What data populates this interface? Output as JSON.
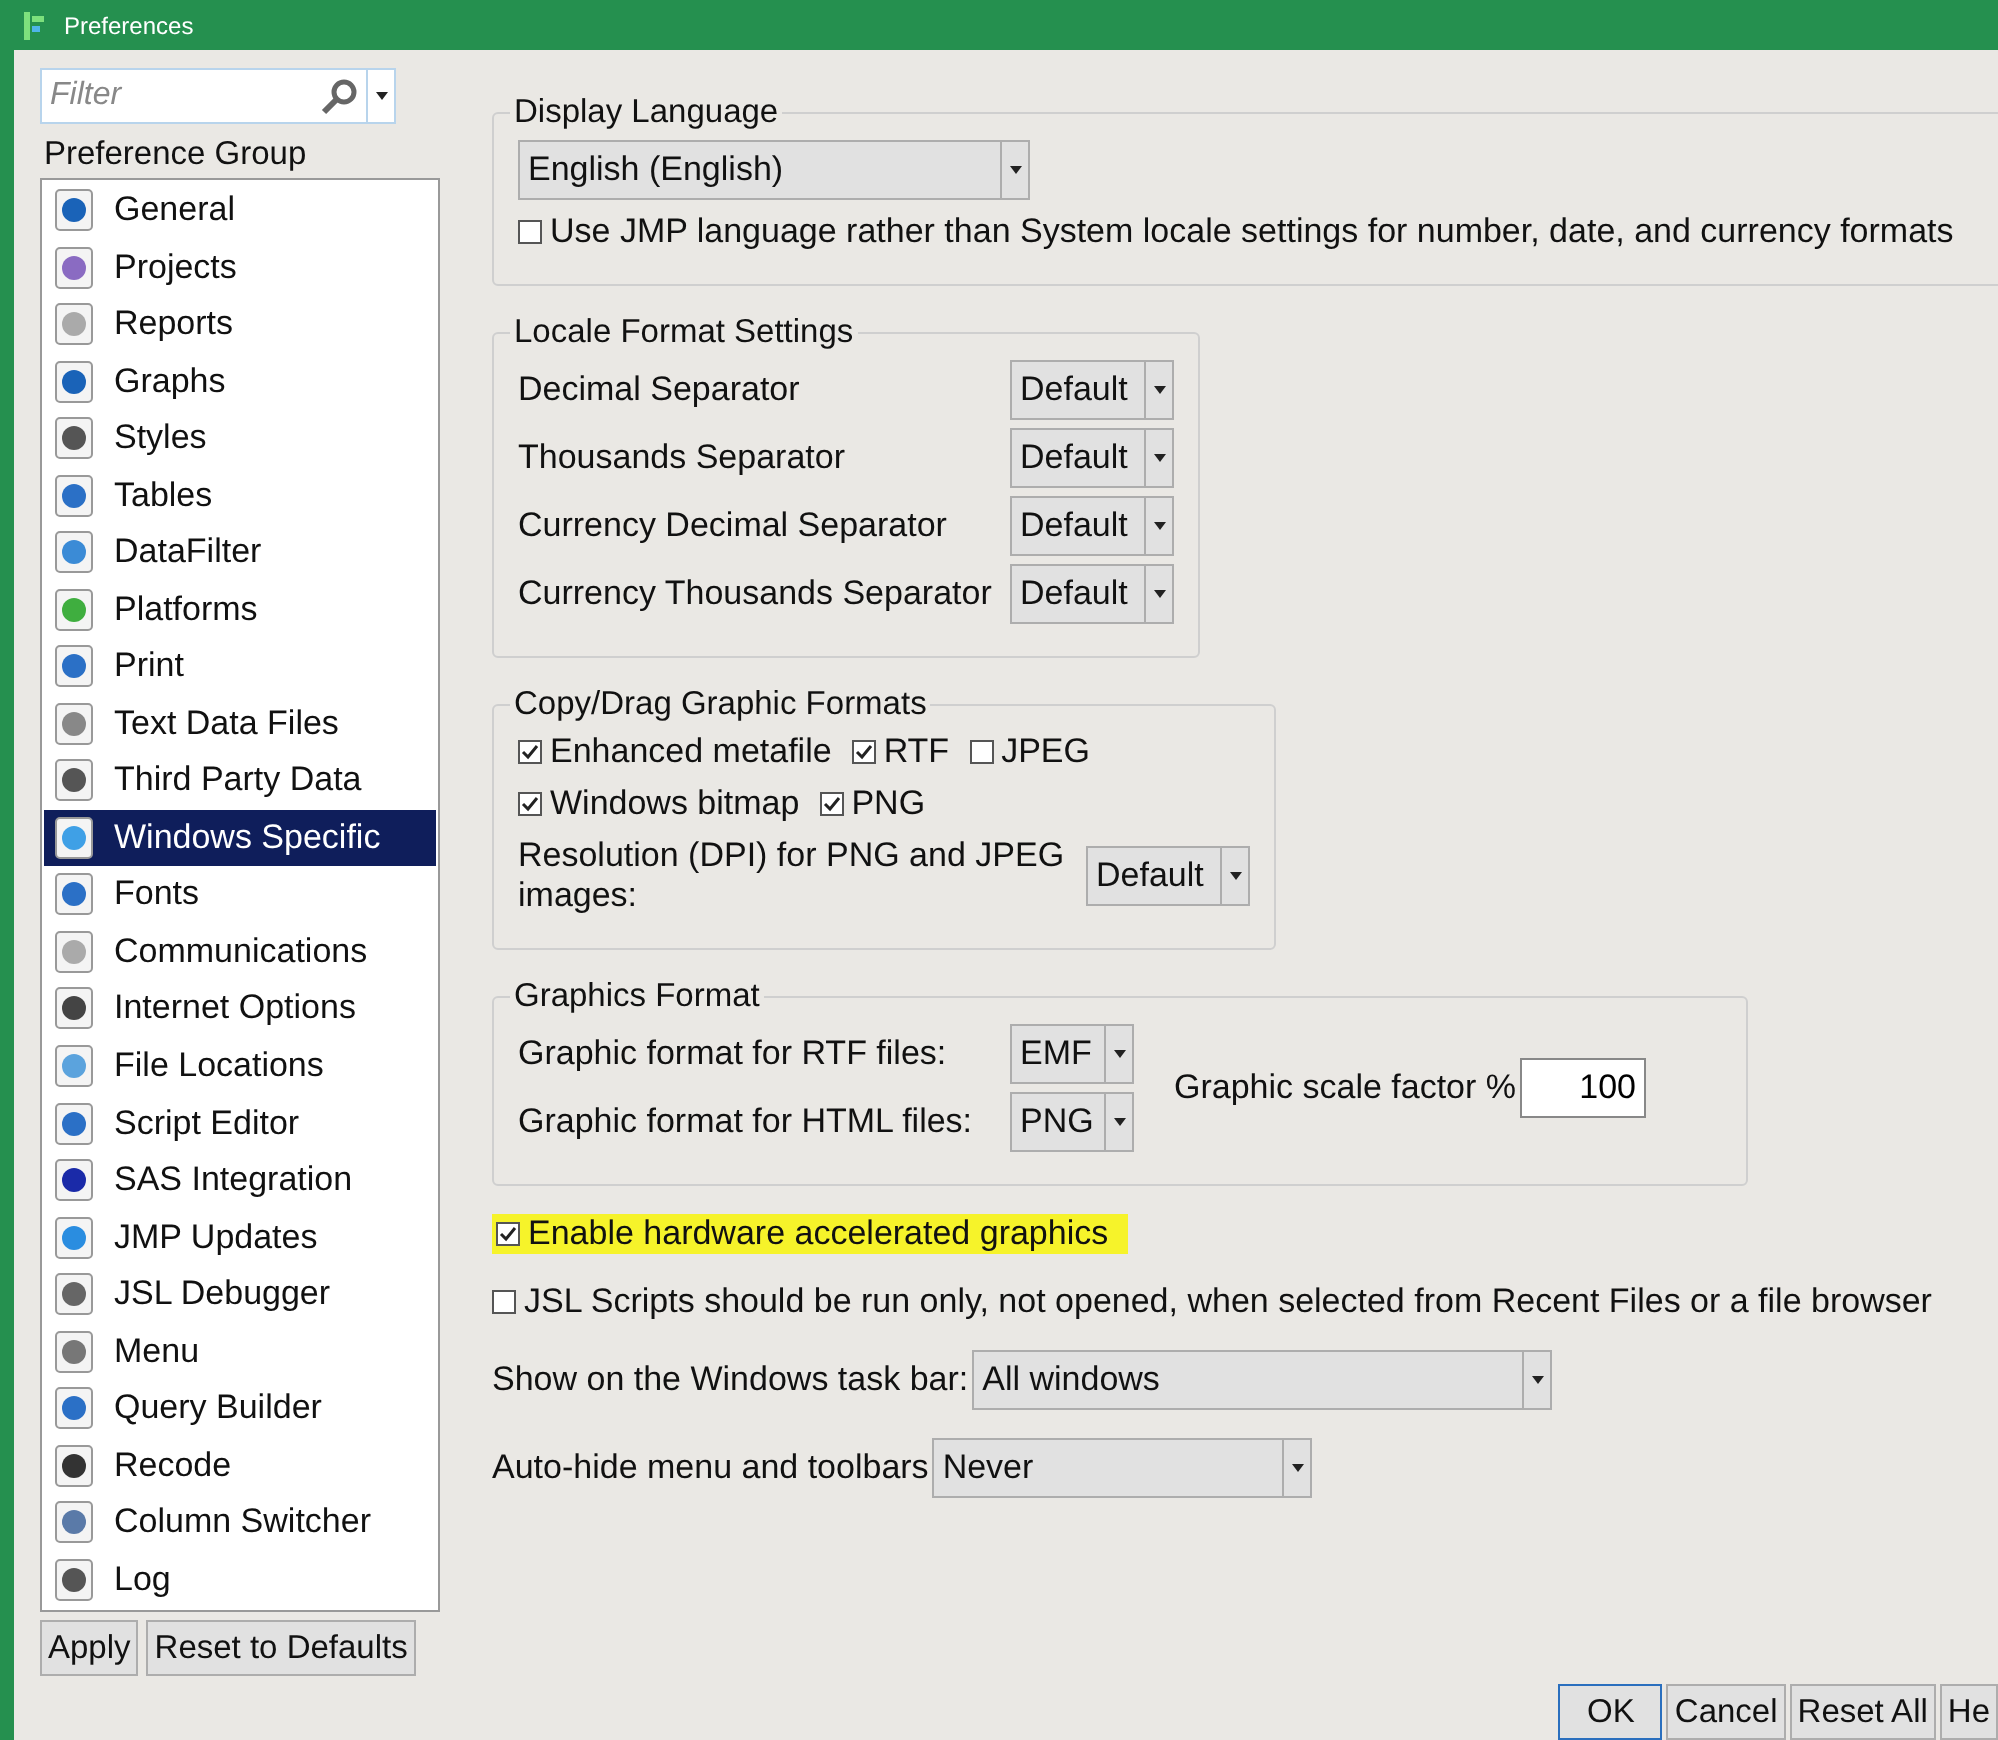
{
  "window": {
    "title": "Preferences"
  },
  "filter": {
    "placeholder": "Filter"
  },
  "group_label": "Preference Group",
  "groups": [
    {
      "label": "General",
      "selected": false
    },
    {
      "label": "Projects",
      "selected": false
    },
    {
      "label": "Reports",
      "selected": false
    },
    {
      "label": "Graphs",
      "selected": false
    },
    {
      "label": "Styles",
      "selected": false
    },
    {
      "label": "Tables",
      "selected": false
    },
    {
      "label": "DataFilter",
      "selected": false
    },
    {
      "label": "Platforms",
      "selected": false
    },
    {
      "label": "Print",
      "selected": false
    },
    {
      "label": "Text Data Files",
      "selected": false
    },
    {
      "label": "Third Party Data",
      "selected": false
    },
    {
      "label": "Windows Specific",
      "selected": true
    },
    {
      "label": "Fonts",
      "selected": false
    },
    {
      "label": "Communications",
      "selected": false
    },
    {
      "label": "Internet Options",
      "selected": false
    },
    {
      "label": "File Locations",
      "selected": false
    },
    {
      "label": "Script Editor",
      "selected": false
    },
    {
      "label": "SAS Integration",
      "selected": false
    },
    {
      "label": "JMP Updates",
      "selected": false
    },
    {
      "label": "JSL Debugger",
      "selected": false
    },
    {
      "label": "Menu",
      "selected": false
    },
    {
      "label": "Query Builder",
      "selected": false
    },
    {
      "label": "Recode",
      "selected": false
    },
    {
      "label": "Column Switcher",
      "selected": false
    },
    {
      "label": "Log",
      "selected": false
    }
  ],
  "left_buttons": [
    "Apply",
    "Reset to Defaults"
  ],
  "display_language": {
    "title": "Display Language",
    "value": "English (English)",
    "option": {
      "label": "Use JMP language rather than System locale settings for number, date, and currency formats",
      "checked": false
    }
  },
  "locale_format": {
    "title": "Locale Format Settings",
    "rows": [
      {
        "label": "Decimal Separator",
        "value": "Default"
      },
      {
        "label": "Thousands Separator",
        "value": "Default"
      },
      {
        "label": "Currency Decimal Separator",
        "value": "Default"
      },
      {
        "label": "Currency Thousands Separator",
        "value": "Default"
      }
    ]
  },
  "copy_drag": {
    "title": "Copy/Drag Graphic Formats",
    "rows": [
      [
        {
          "label": "Enhanced metafile",
          "checked": true
        },
        {
          "label": "RTF",
          "checked": true
        },
        {
          "label": "JPEG",
          "checked": false
        }
      ],
      [
        {
          "label": "Windows bitmap",
          "checked": true
        },
        {
          "label": "PNG",
          "checked": true
        }
      ]
    ],
    "resolution": {
      "label": "Resolution (DPI) for PNG and JPEG images:",
      "value": "Default"
    }
  },
  "graphics_format": {
    "title": "Graphics Format",
    "rows": [
      {
        "label": "Graphic format for RTF files:",
        "value": "EMF"
      },
      {
        "label": "Graphic format for HTML files:",
        "value": "PNG"
      }
    ],
    "scale": {
      "label": "Graphic scale factor %",
      "value": "100"
    }
  },
  "options": [
    {
      "label": "Enable hardware accelerated graphics",
      "checked": true,
      "highlighted": true
    },
    {
      "label": "JSL Scripts should be run only, not opened, when selected from Recent Files or a file browser",
      "checked": false,
      "highlighted": false
    }
  ],
  "taskbar": {
    "label": "Show on the Windows task bar:",
    "value": "All windows"
  },
  "autohide": {
    "label": "Auto-hide menu and toolbars",
    "value": "Never"
  },
  "dialog_buttons": [
    {
      "label": "OK",
      "default": true
    },
    {
      "label": "Cancel",
      "default": false
    },
    {
      "label": "Reset All",
      "default": false
    },
    {
      "label": "He",
      "default": false
    }
  ]
}
